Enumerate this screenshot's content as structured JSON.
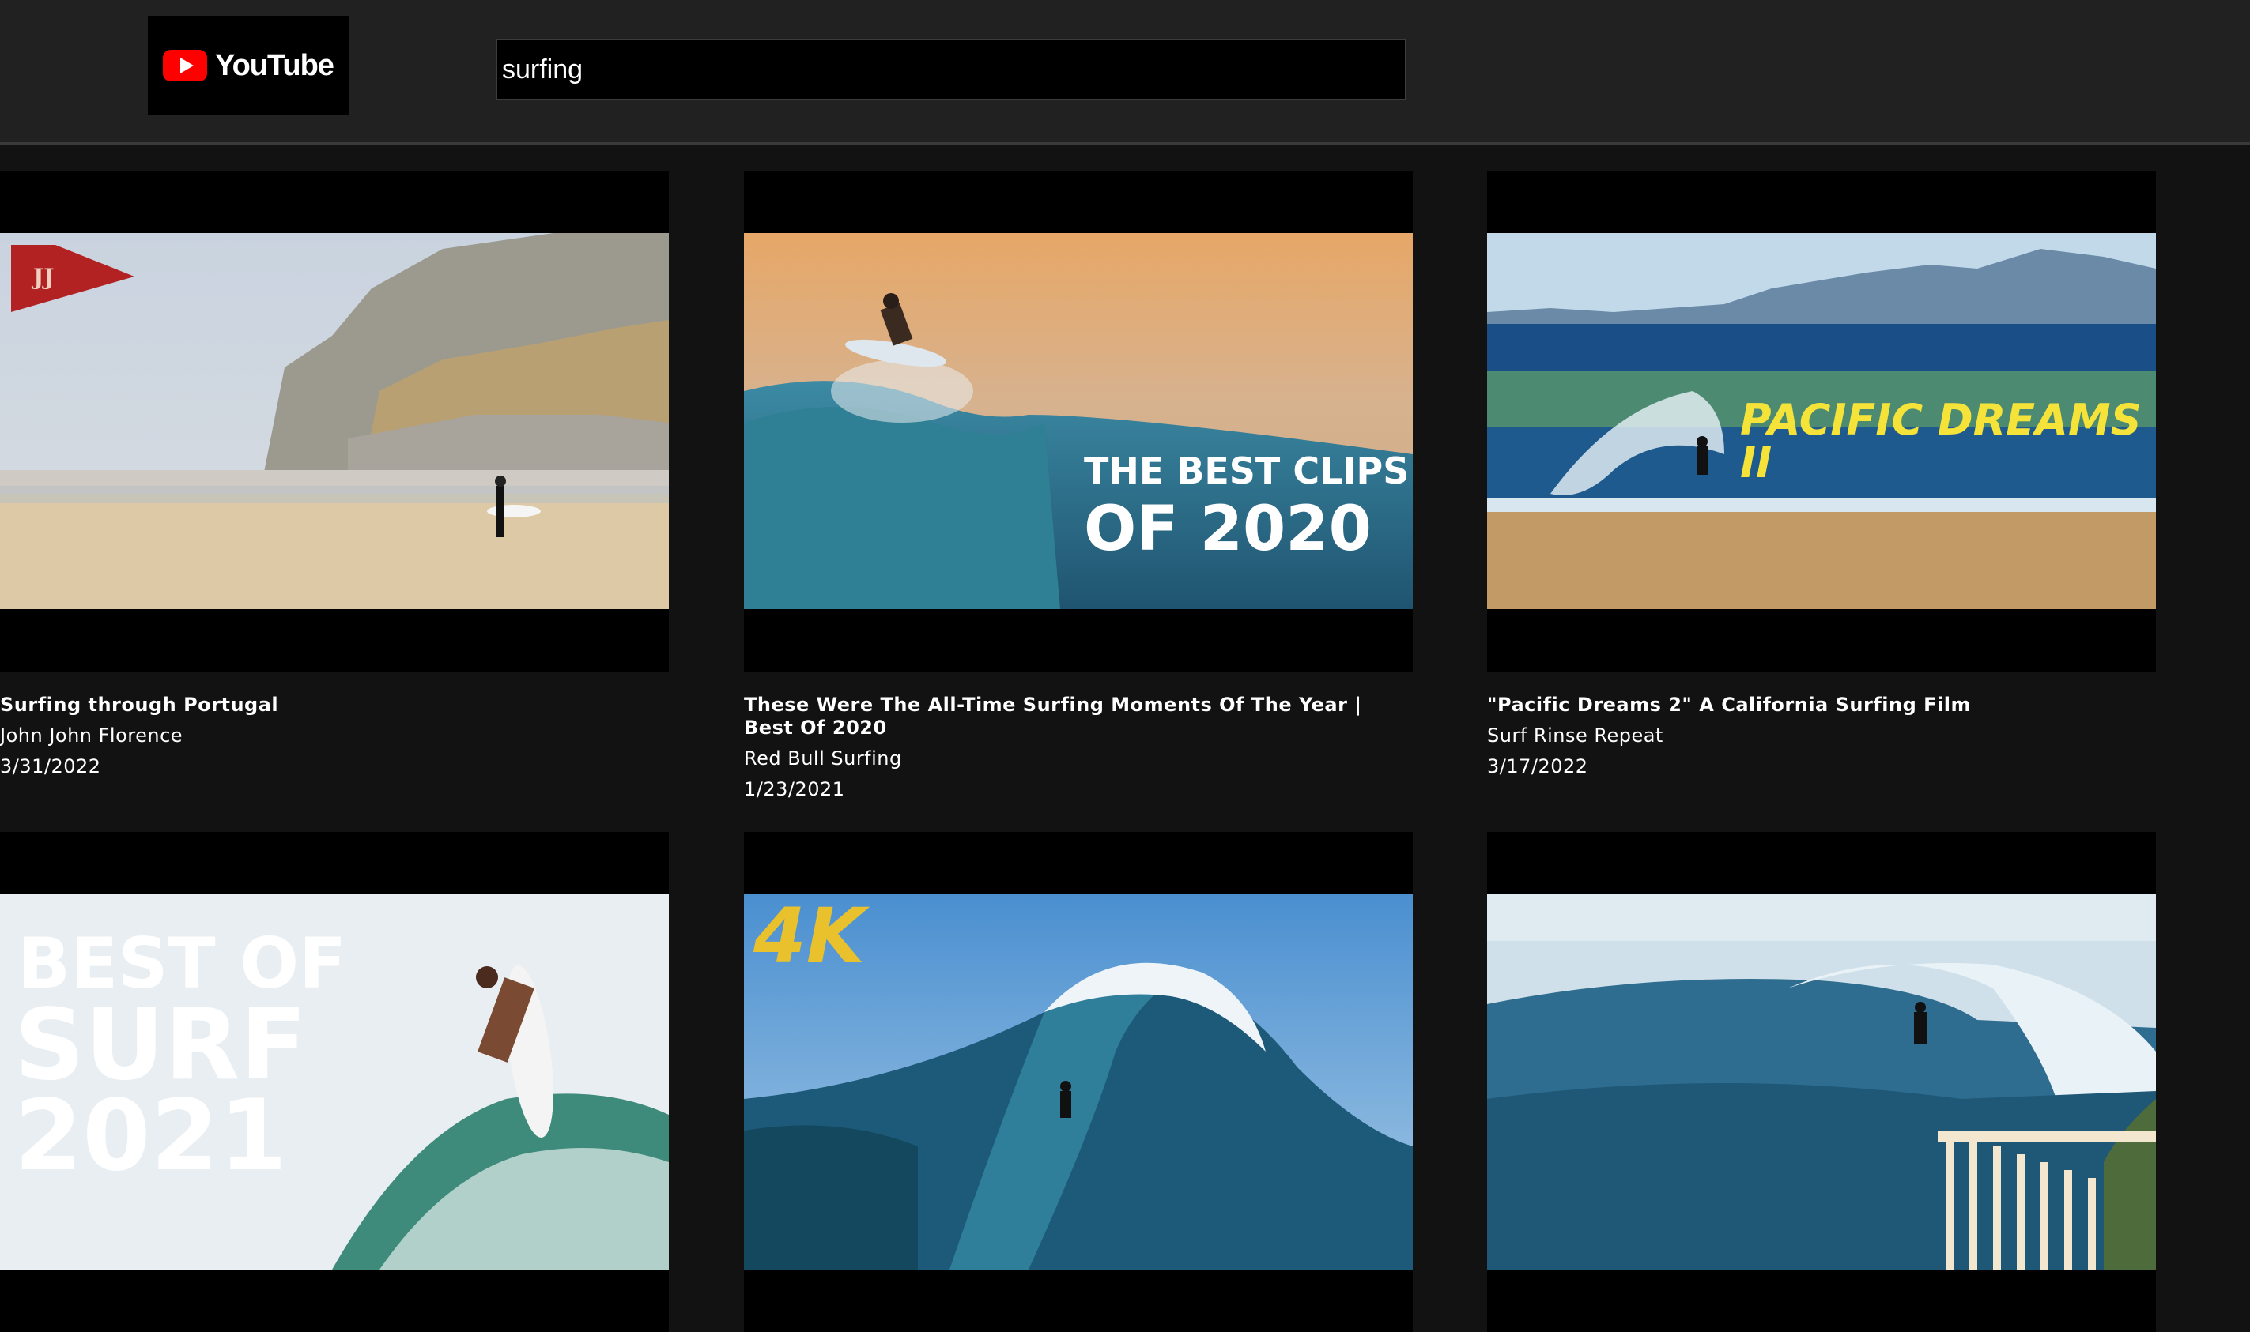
{
  "header": {
    "logo_text": "YouTube",
    "search_value": "surfing"
  },
  "videos": [
    {
      "title": "Surfing through Portugal",
      "channel": "John John Florence",
      "date": "3/31/2022",
      "thumb_badge": "JJ"
    },
    {
      "title": "These Were The All-Time Surfing Moments Of The Year | Best Of 2020",
      "channel": "Red Bull Surfing",
      "date": "1/23/2021",
      "thumb_line1": "THE BEST CLIPS",
      "thumb_line2": "OF 2020"
    },
    {
      "title": "\"Pacific Dreams 2\" A California Surfing Film",
      "channel": "Surf Rinse Repeat",
      "date": "3/17/2022",
      "thumb_text": "PACIFIC DREAMS II"
    },
    {
      "thumb_line1": "BEST OF",
      "thumb_line2": "SURF",
      "thumb_line3": "2021"
    },
    {
      "thumb_text": "4K"
    },
    {}
  ]
}
